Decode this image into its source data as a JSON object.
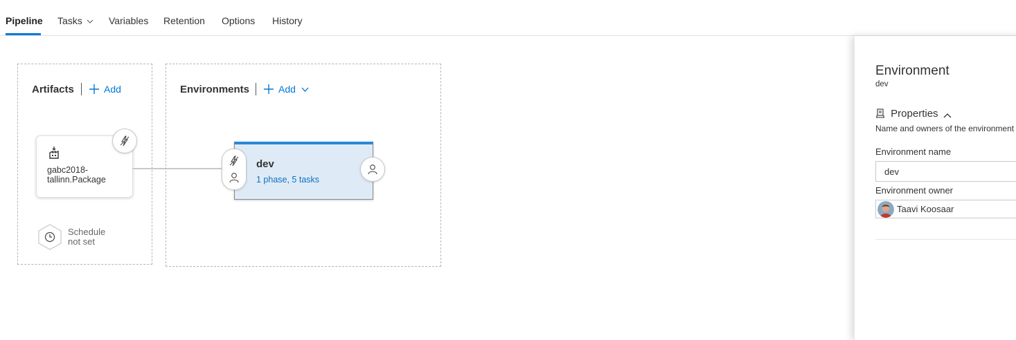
{
  "tabs": [
    {
      "label": "Pipeline",
      "active": true
    },
    {
      "label": "Tasks",
      "has_dropdown": true
    },
    {
      "label": "Variables"
    },
    {
      "label": "Retention"
    },
    {
      "label": "Options"
    },
    {
      "label": "History"
    }
  ],
  "artifacts": {
    "title": "Artifacts",
    "add_label": "Add",
    "item": {
      "name": "gabc2018-tallinn.Package",
      "icon": "build-artifact-icon"
    },
    "schedule_line1": "Schedule",
    "schedule_line2": "not set"
  },
  "environments": {
    "title": "Environments",
    "add_label": "Add",
    "item": {
      "name": "dev",
      "summary": "1 phase, 5 tasks"
    }
  },
  "side_panel": {
    "title": "Environment",
    "subtitle": "dev",
    "section_title": "Properties",
    "section_desc": "Name and owners of the environment",
    "name_label": "Environment name",
    "name_value": "dev",
    "owner_label": "Environment owner",
    "owner_name": "Taavi Koosaar"
  },
  "colors": {
    "accent": "#0078d4",
    "env_card": "#deebf7",
    "env_bar": "#2b88d8"
  }
}
